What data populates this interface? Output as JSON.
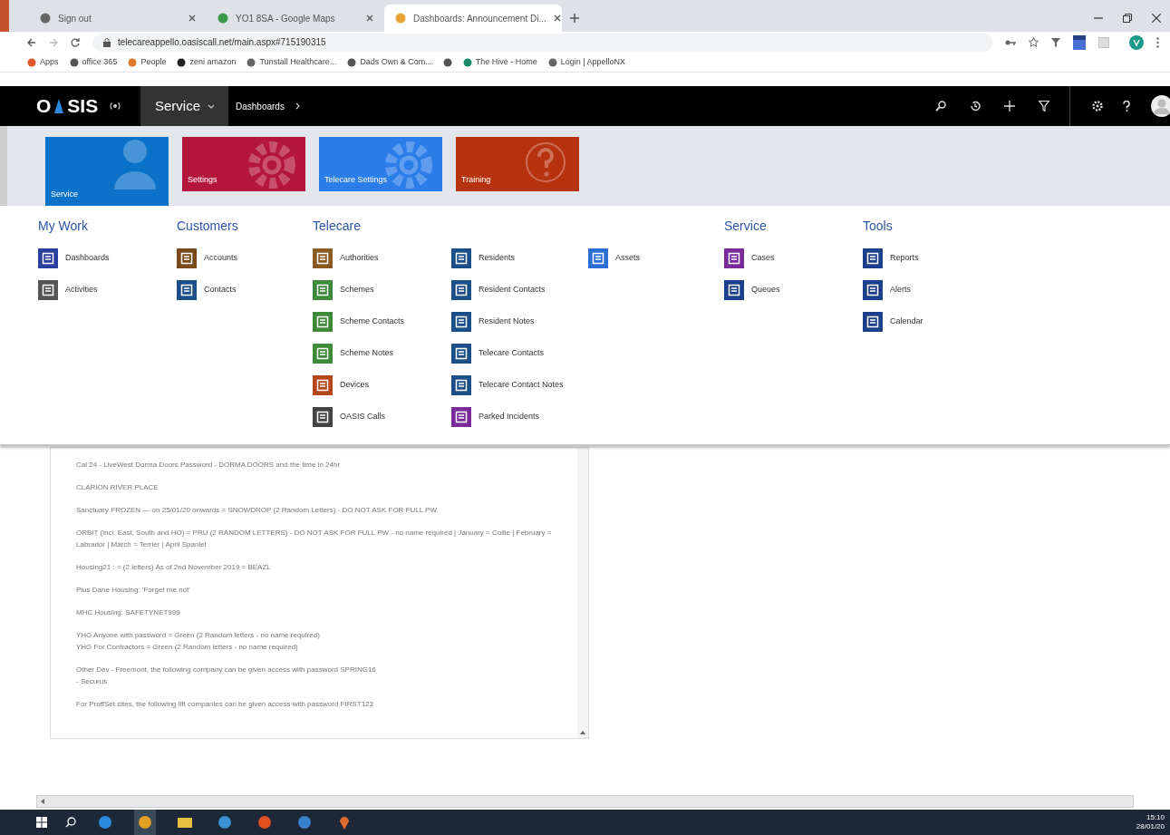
{
  "browser": {
    "tabs": [
      {
        "title": "Sign out",
        "selected": false
      },
      {
        "title": "YO1 8SA - Google Maps",
        "selected": false
      },
      {
        "title": "Dashboards: Announcement Di...",
        "selected": true
      }
    ],
    "address": "telecareappello.oasiscall.net/main.aspx#715190315",
    "bookmarks": [
      {
        "kind": "link",
        "label": "Apps"
      },
      {
        "kind": "link",
        "label": "office 365"
      },
      {
        "kind": "link",
        "label": "People"
      },
      {
        "kind": "link",
        "label": "zeni amazon"
      },
      {
        "kind": "link",
        "label": "Tunstall Healthcare..."
      },
      {
        "kind": "link",
        "label": "Dads Own & Com..."
      },
      {
        "kind": "icon"
      },
      {
        "kind": "link",
        "label": "The Hive - Home"
      },
      {
        "kind": "link",
        "label": "Login | AppelloNX"
      }
    ]
  },
  "nav": {
    "logo_left": "O",
    "logo_right": "SIS",
    "area": "Service",
    "breadcrumb": "Dashboards"
  },
  "tiles": [
    {
      "label": "Service",
      "color": "#0a72c8",
      "kind": "person",
      "selected": true
    },
    {
      "label": "Settings",
      "color": "#b5173c",
      "kind": "gear",
      "selected": false
    },
    {
      "label": "Telecare Settings",
      "color": "#2b7de9",
      "kind": "gear",
      "selected": false
    },
    {
      "label": "Training",
      "color": "#b7320f",
      "kind": "help",
      "selected": false
    }
  ],
  "menu": [
    {
      "title": "My Work",
      "columns": [
        [
          {
            "label": "Dashboards",
            "color": "#2b3f9e"
          },
          {
            "label": "Activities",
            "color": "#555555"
          }
        ]
      ]
    },
    {
      "title": "Customers",
      "columns": [
        [
          {
            "label": "Accounts",
            "color": "#7a4a1a"
          },
          {
            "label": "Contacts",
            "color": "#1c4f8a"
          }
        ]
      ]
    },
    {
      "title": "Telecare",
      "columns": [
        [
          {
            "label": "Authorities",
            "color": "#8a5a20"
          },
          {
            "label": "Schemes",
            "color": "#3f8a3a"
          },
          {
            "label": "Scheme Contacts",
            "color": "#3f8a3a"
          },
          {
            "label": "Scheme Notes",
            "color": "#3f8a3a"
          },
          {
            "label": "Devices",
            "color": "#b5471a"
          },
          {
            "label": "OASIS Calls",
            "color": "#444444"
          }
        ],
        [
          {
            "label": "Residents",
            "color": "#1c4f8a"
          },
          {
            "label": "Resident Contacts",
            "color": "#1c4f8a"
          },
          {
            "label": "Resident Notes",
            "color": "#1c4f8a"
          },
          {
            "label": "Telecare Contacts",
            "color": "#1c4f8a"
          },
          {
            "label": "Telecare Contact Notes",
            "color": "#1c4f8a"
          },
          {
            "label": "Parked Incidents",
            "color": "#7b2a9a"
          }
        ],
        [
          {
            "label": "Assets",
            "color": "#2b6fd4"
          }
        ]
      ]
    },
    {
      "title": "Service",
      "columns": [
        [
          {
            "label": "Cases",
            "color": "#7b2a9a"
          },
          {
            "label": "Queues",
            "color": "#1c3f8a"
          }
        ]
      ]
    },
    {
      "title": "Tools",
      "columns": [
        [
          {
            "label": "Reports",
            "color": "#1c3f8a"
          },
          {
            "label": "Alerts",
            "color": "#1c3f8a"
          },
          {
            "label": "Calendar",
            "color": "#1c3f8a"
          }
        ]
      ]
    }
  ],
  "announcement": [
    "Cal 24 - LiveWest Dorma Doors Password - DORMA DOORS and the time in 24hr",
    "CLARION RIVER PLACE",
    "Sanctuary FROZEN — on 25/01/20 onwards = SNOWDROP (2 Random Letters) - DO NOT ASK FOR FULL PW",
    "ORBIT (incl. East, South and HO) = PRU (2 RANDOM LETTERS) - DO NOT ASK FOR FULL PW - no name required | January = Collie | February = Labrador | March = Terrier | April Spaniel",
    "Housing21 : = (2 letters) As of 2nd November 2019 = BEAZL",
    "Plus Dane Housing: 'Forget me not'",
    "MHC Housing: SAFETYNET999",
    "YHG Anyone with password = Green (2 Random letters - no name required)\nYHG For Contractors = Green (2 Random letters - no name required)",
    "Other Dev - Freemont, the following company can be given access with password SPRING16\n- Securus",
    "For ProffSet sites, the following lift companies can be given access with password FIRST123"
  ],
  "taskbar": {
    "time": "15:10",
    "date": "28/01/20"
  }
}
